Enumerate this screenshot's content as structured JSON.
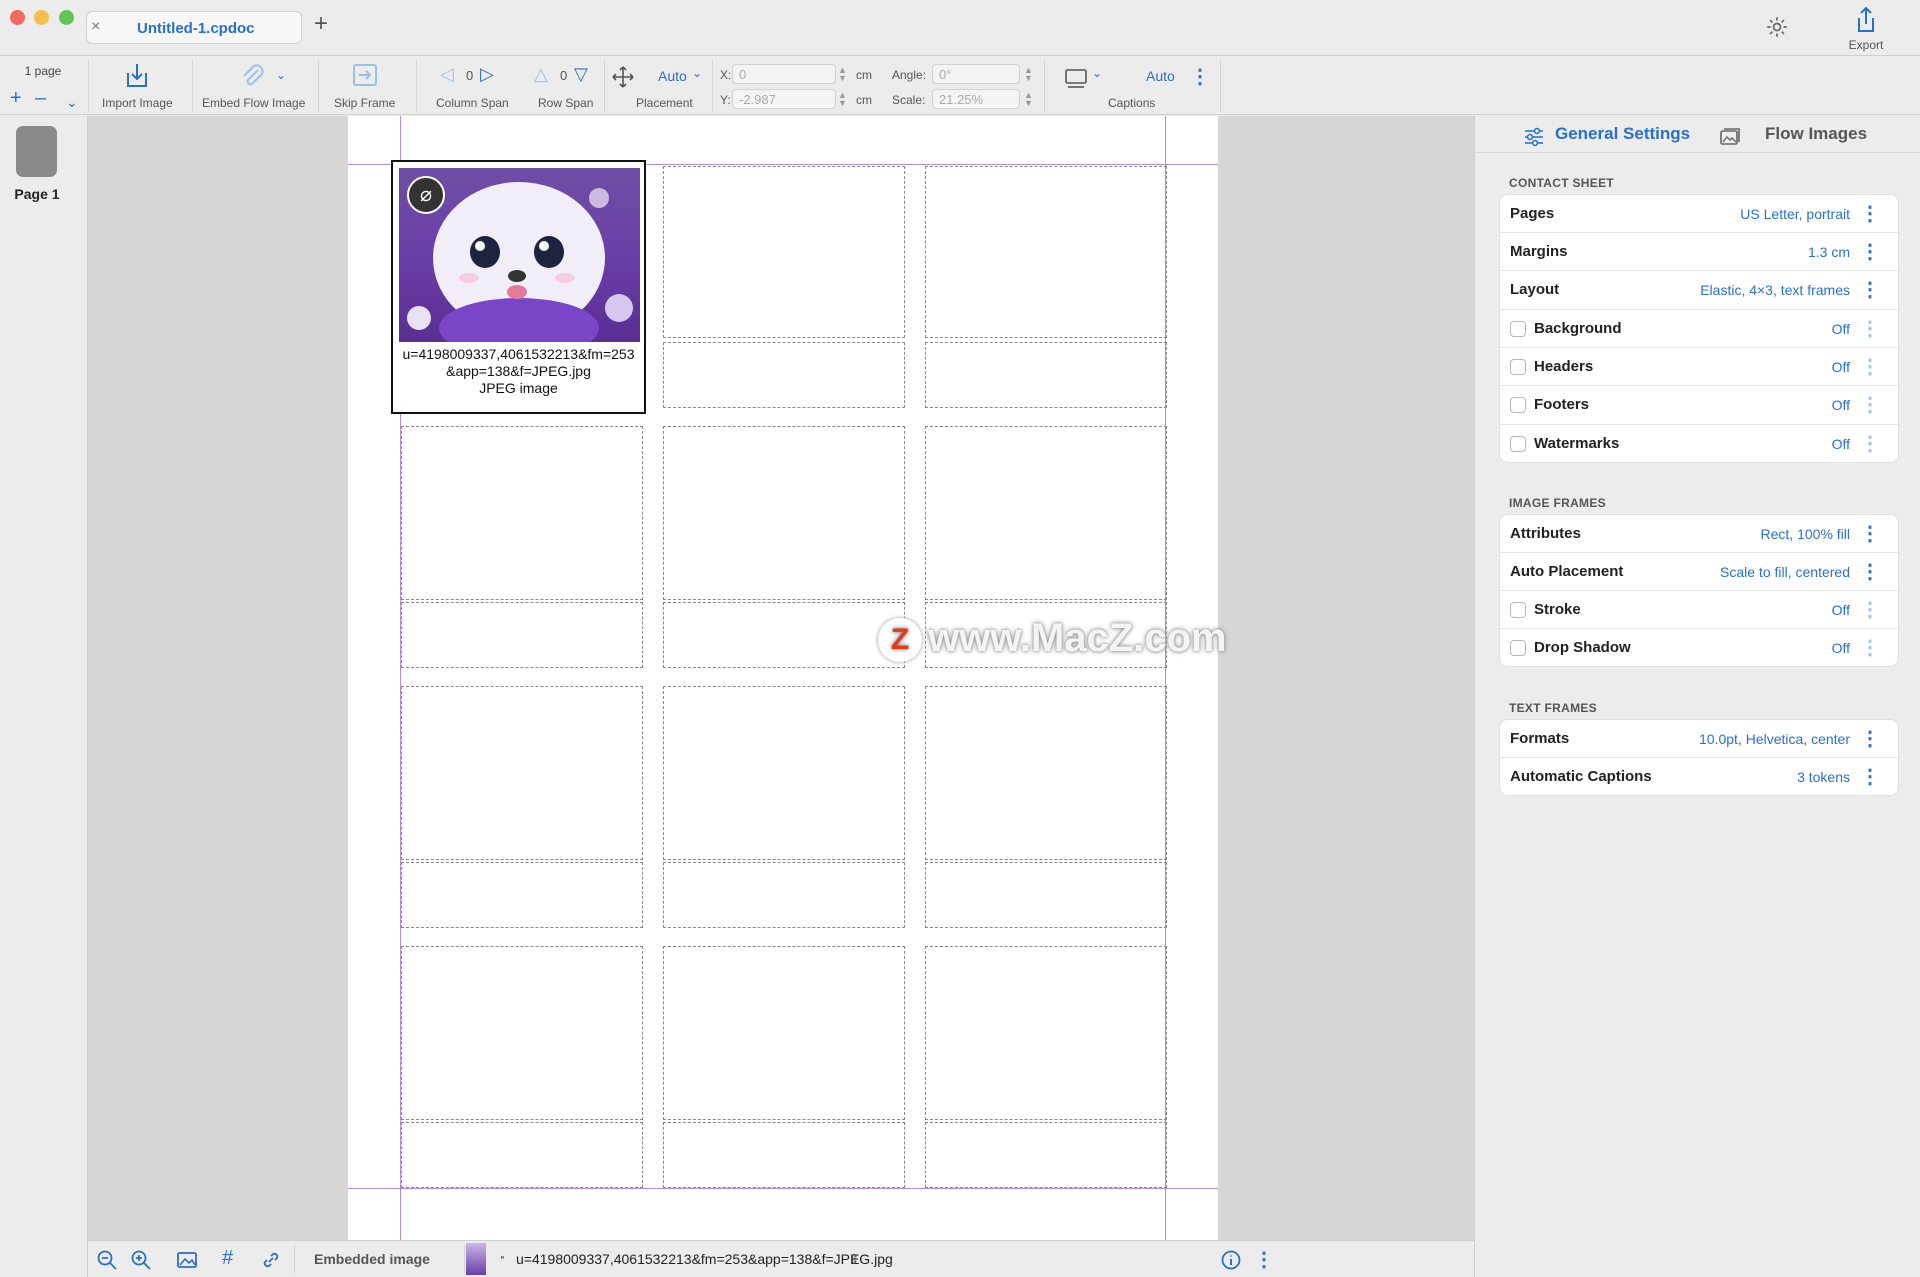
{
  "window": {
    "tab_title": "Untitled-1.cpdoc",
    "tab_close": "×",
    "tab_add": "+",
    "export_label": "Export"
  },
  "toolbar": {
    "page_count": "1 page",
    "add": "+",
    "remove": "–",
    "more": "⌄",
    "import_image": "Import Image",
    "embed_flow_image": "Embed Flow Image",
    "skip_frame": "Skip Frame",
    "column_span_value": "0",
    "column_span": "Column Span",
    "row_span_value": "0",
    "row_span": "Row Span",
    "placement_value": "Auto",
    "placement": "Placement",
    "x_label": "X:",
    "x_value": "0",
    "y_label": "Y:",
    "y_value": "-2.987",
    "unit": "cm",
    "angle_label": "Angle:",
    "angle_value": "0°",
    "scale_label": "Scale:",
    "scale_value": "21.25%",
    "captions_value": "Auto",
    "captions": "Captions"
  },
  "sidebar": {
    "page_label": "Page 1"
  },
  "canvas": {
    "caption_line1": "u=4198009337,4061532213&fm=253",
    "caption_line2": "&app=138&f=JPEG.jpg",
    "caption_line3": "JPEG image",
    "watermark_text": "www.MacZ.com",
    "watermark_logo": "Z"
  },
  "bottombar": {
    "mode_label": "Embedded image",
    "file_name": "u=4198009337,4061532213&fm=253&app=138&f=JPEG.jpg",
    "file_marker": "⁍",
    "selector": "⇕"
  },
  "panel": {
    "tab_general": "General Settings",
    "tab_flow": "Flow Images",
    "sections": {
      "contact_sheet": "CONTACT SHEET",
      "image_frames": "IMAGE FRAMES",
      "text_frames": "TEXT FRAMES"
    },
    "contact_sheet": [
      {
        "label": "Pages",
        "value": "US Letter, portrait"
      },
      {
        "label": "Margins",
        "value": "1.3 cm"
      },
      {
        "label": "Layout",
        "value": "Elastic, 4×3, text frames"
      },
      {
        "label": "Background",
        "value": "Off"
      },
      {
        "label": "Headers",
        "value": "Off"
      },
      {
        "label": "Footers",
        "value": "Off"
      },
      {
        "label": "Watermarks",
        "value": "Off"
      }
    ],
    "image_frames": [
      {
        "label": "Attributes",
        "value": "Rect, 100% fill"
      },
      {
        "label": "Auto Placement",
        "value": "Scale to fill, centered"
      },
      {
        "label": "Stroke",
        "value": "Off"
      },
      {
        "label": "Drop Shadow",
        "value": "Off"
      }
    ],
    "text_frames": [
      {
        "label": "Formats",
        "value": "10.0pt, Helvetica, center"
      },
      {
        "label": "Automatic Captions",
        "value": "3 tokens"
      }
    ]
  },
  "colors": {
    "accent": "#2a6fc9",
    "close": "#ed6a5e",
    "minimize": "#f5bf4f",
    "zoom": "#61c554",
    "guide": "#b98ad6"
  }
}
